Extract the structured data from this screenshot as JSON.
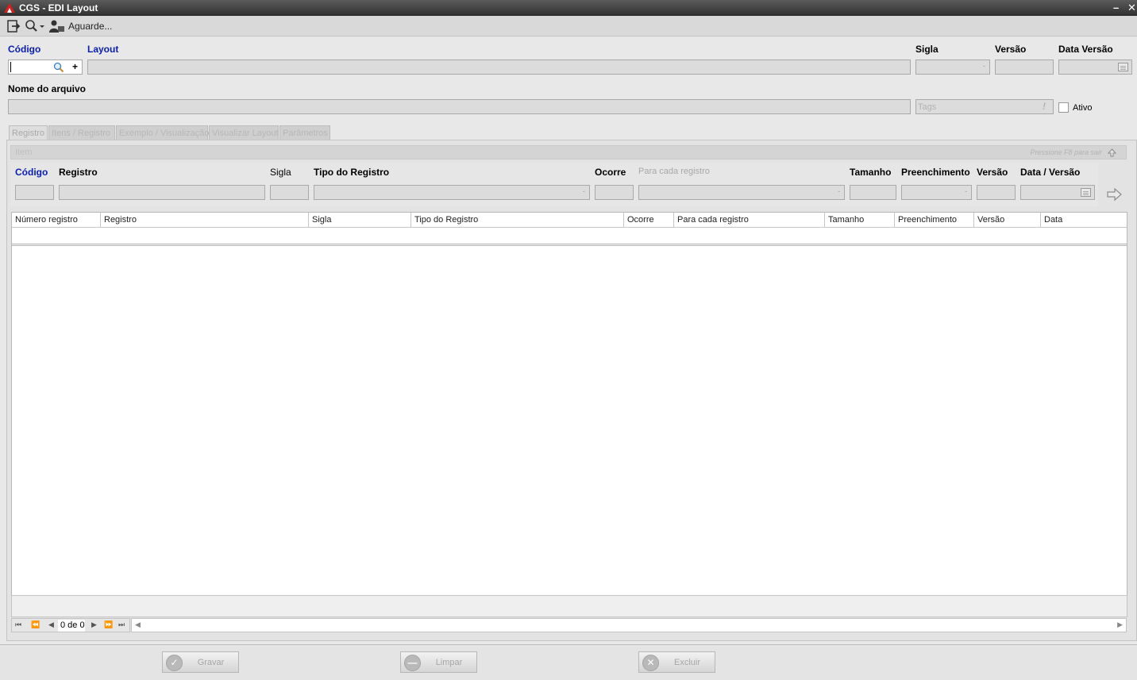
{
  "window": {
    "title": "CGS - EDI Layout",
    "minimize": "–",
    "close": "✕"
  },
  "toolbar": {
    "status": "Aguarde..."
  },
  "form": {
    "codigo_label": "Código",
    "layout_label": "Layout",
    "sigla_label": "Sigla",
    "versao_label": "Versão",
    "data_versao_label": "Data Versão",
    "nome_arquivo_label": "Nome do arquivo",
    "tags_placeholder": "Tags",
    "ativo_label": "Ativo",
    "codigo_value": "",
    "plus": "+"
  },
  "tabs": [
    {
      "label": "Registro"
    },
    {
      "label": "Itens / Registro"
    },
    {
      "label": "Exemplo / Visualização"
    },
    {
      "label": "Visualizar Layout"
    },
    {
      "label": "Parâmetros"
    }
  ],
  "item_panel": {
    "title": "Item",
    "hint": "Pressione F8 para sair",
    "codigo_label": "Código",
    "registro_label": "Registro",
    "sigla_label": "Sigla",
    "tipo_label": "Tipo do Registro",
    "ocorre_label": "Ocorre",
    "para_cada_label": "Para cada registro",
    "tamanho_label": "Tamanho",
    "preenchimento_label": "Preenchimento",
    "versao_label": "Versão",
    "data_versao_label": "Data / Versão"
  },
  "grid": {
    "columns": [
      "Número registro",
      "Registro",
      "Sigla",
      "Tipo do Registro",
      "Ocorre",
      "Para cada registro",
      "Tamanho",
      "Preenchimento",
      "Versão",
      "Data"
    ],
    "rows": []
  },
  "pager": {
    "count": "0 de 0"
  },
  "actions": {
    "save": "Gravar",
    "clear": "Limpar",
    "delete": "Excluir"
  }
}
